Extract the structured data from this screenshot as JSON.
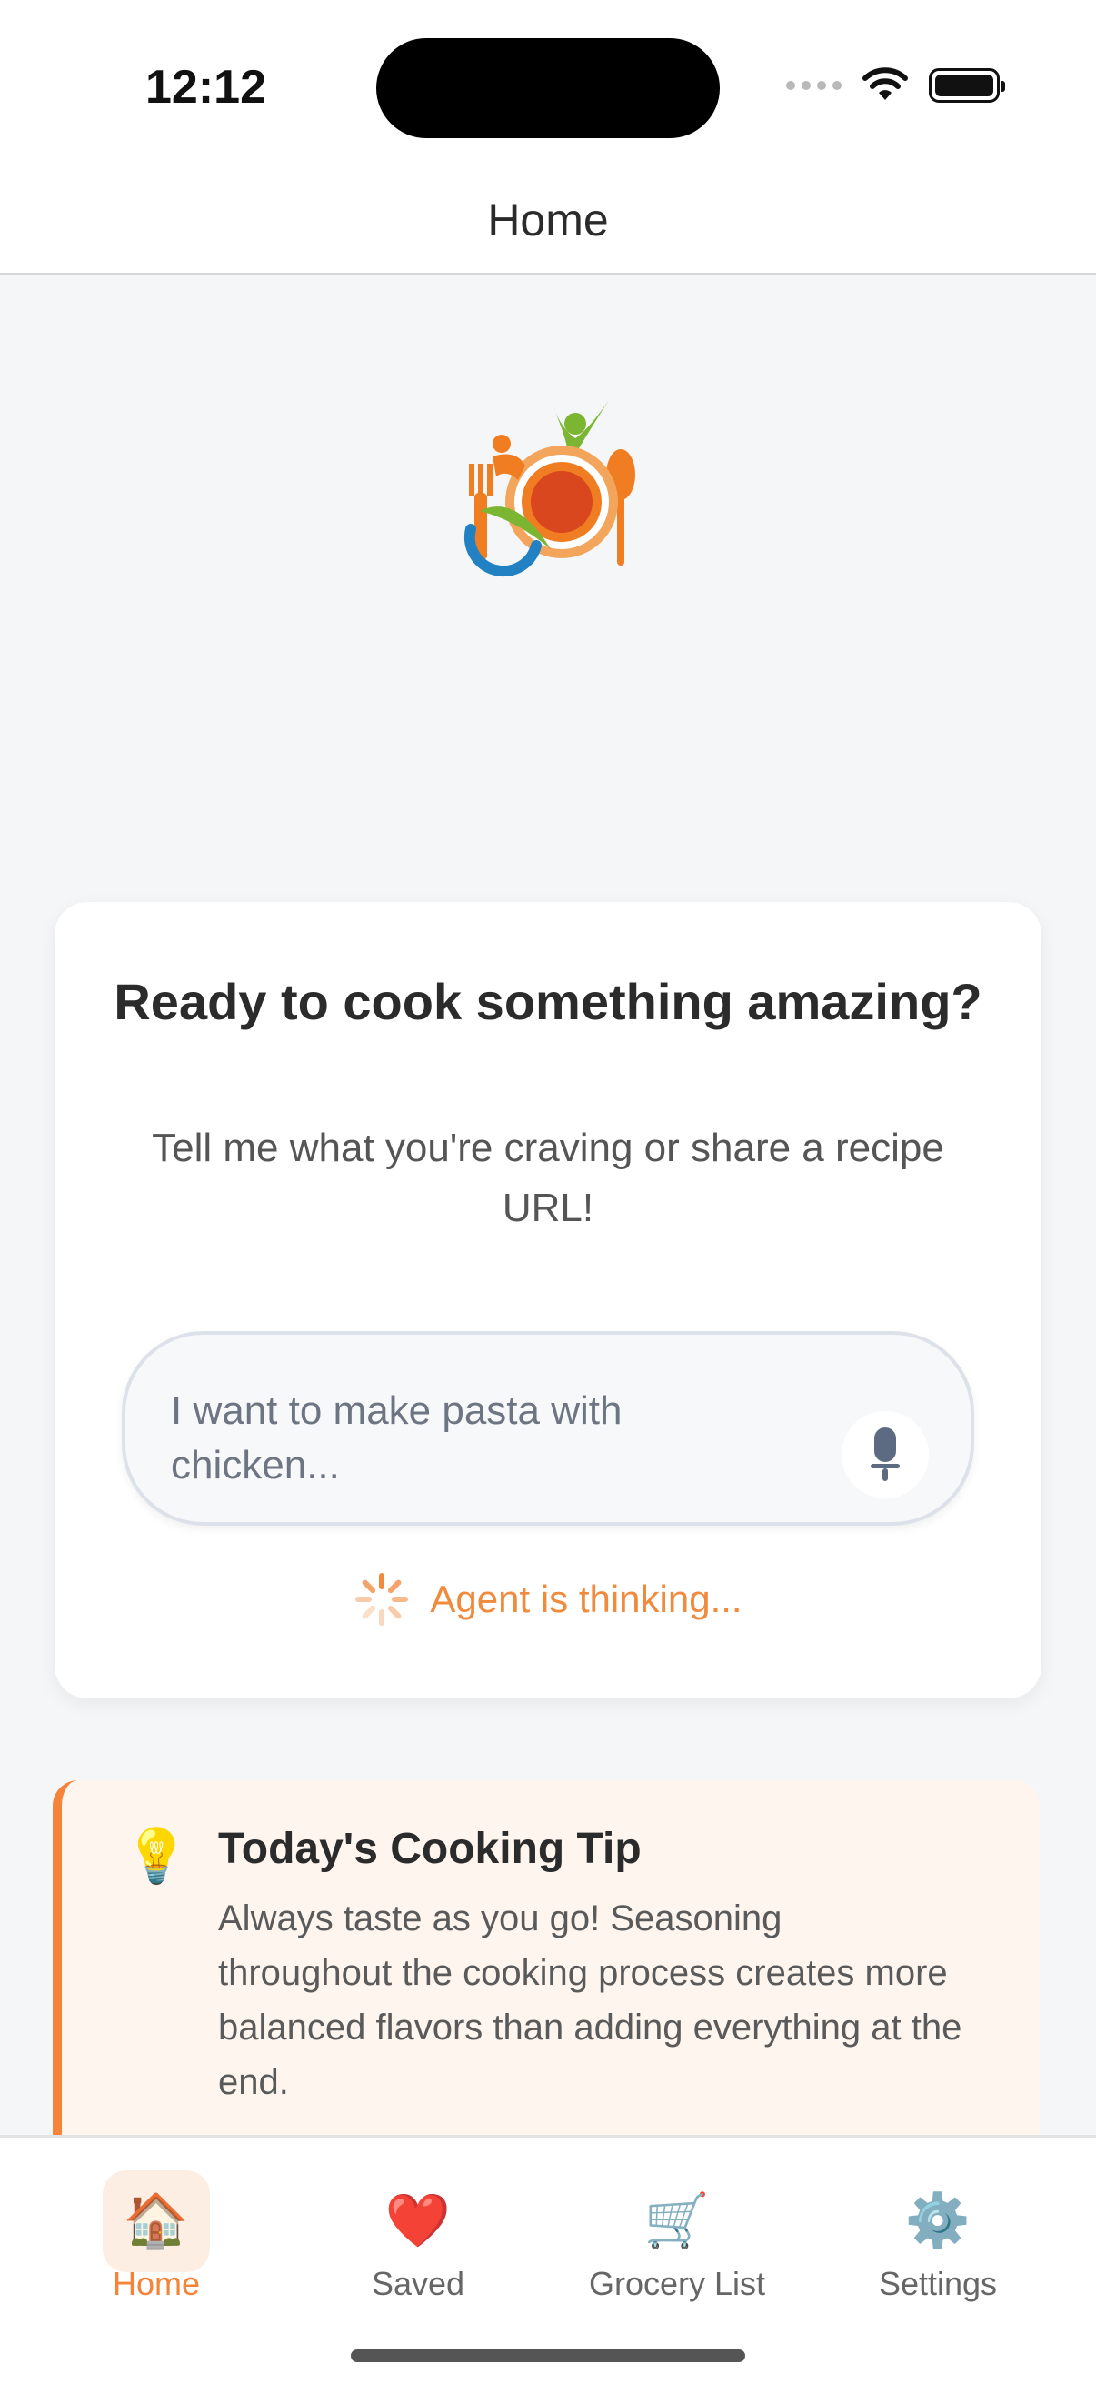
{
  "status_bar": {
    "time": "12:12"
  },
  "header": {
    "title": "Home"
  },
  "card": {
    "title": "Ready to cook something amazing?",
    "subtitle": "Tell me what you're craving or share a recipe URL!",
    "input_placeholder": "I want to make pasta with chicken...",
    "status_text": "Agent is thinking..."
  },
  "tip": {
    "title": "Today's Cooking Tip",
    "body": "Always taste as you go! Seasoning throughout the cooking process creates more balanced flavors than adding everything at the end.",
    "icon": "lightbulb-icon"
  },
  "tabs": [
    {
      "label": "Home",
      "icon": "house-icon",
      "active": true
    },
    {
      "label": "Saved",
      "icon": "heart-icon",
      "active": false
    },
    {
      "label": "Grocery List",
      "icon": "cart-icon",
      "active": false
    },
    {
      "label": "Settings",
      "icon": "gear-icon",
      "active": false
    }
  ],
  "colors": {
    "accent": "#f5843a",
    "tip_background": "#fff5ef",
    "page_background": "#f5f6f8"
  }
}
